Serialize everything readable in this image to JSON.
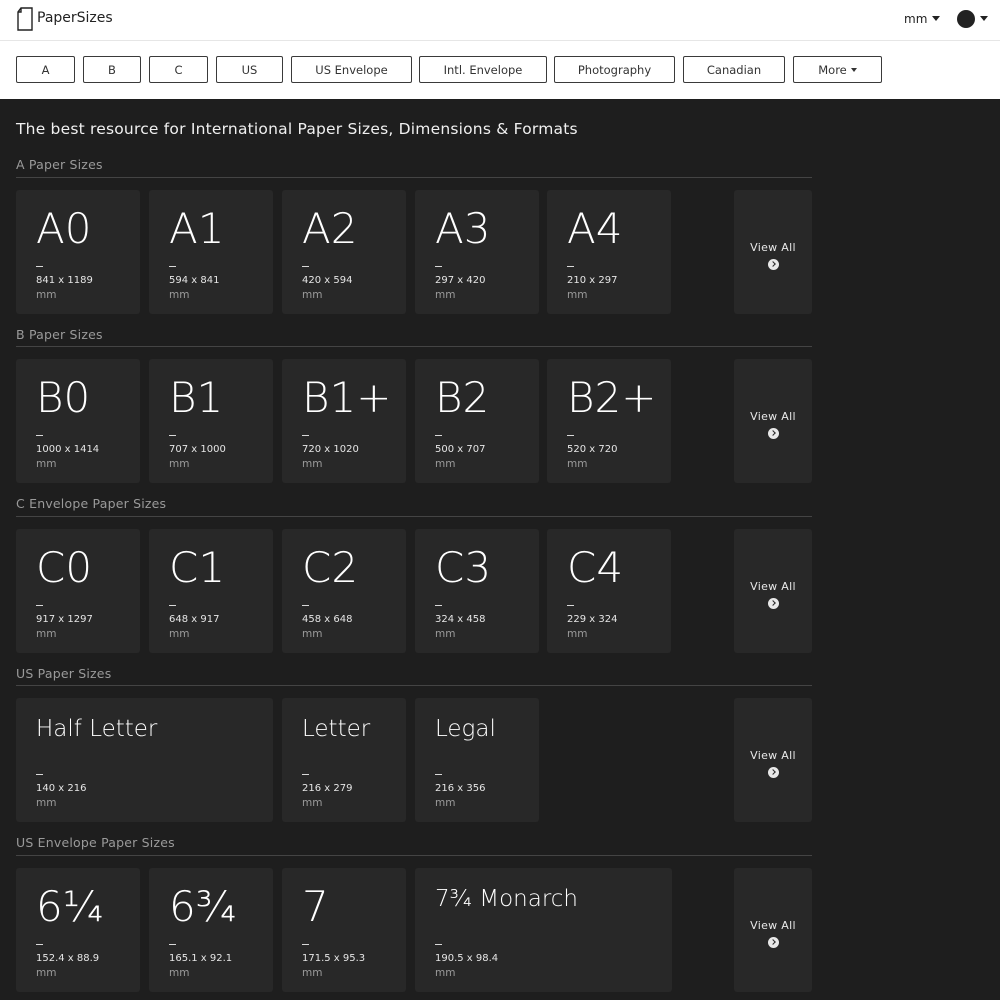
{
  "header": {
    "brand": "PaperSizes",
    "unit_selector": "mm",
    "nav": [
      "A",
      "B",
      "C",
      "US",
      "US Envelope",
      "Intl. Envelope",
      "Photography",
      "Canadian",
      "More"
    ]
  },
  "hero": "The best resource for International Paper Sizes, Dimensions & Formats",
  "view_all_label": "View All",
  "sections": [
    {
      "title": "A Paper Sizes",
      "cards": [
        {
          "name": "A0",
          "dims": "841 x 1189",
          "unit": "mm"
        },
        {
          "name": "A1",
          "dims": "594 x 841",
          "unit": "mm"
        },
        {
          "name": "A2",
          "dims": "420 x 594",
          "unit": "mm"
        },
        {
          "name": "A3",
          "dims": "297 x 420",
          "unit": "mm"
        },
        {
          "name": "A4",
          "dims": "210 x 297",
          "unit": "mm"
        }
      ]
    },
    {
      "title": "B Paper Sizes",
      "cards": [
        {
          "name": "B0",
          "dims": "1000 x 1414",
          "unit": "mm"
        },
        {
          "name": "B1",
          "dims": "707 x 1000",
          "unit": "mm"
        },
        {
          "name": "B1+",
          "dims": "720 x 1020",
          "unit": "mm"
        },
        {
          "name": "B2",
          "dims": "500 x 707",
          "unit": "mm"
        },
        {
          "name": "B2+",
          "dims": "520 x 720",
          "unit": "mm"
        }
      ]
    },
    {
      "title": "C Envelope Paper Sizes",
      "cards": [
        {
          "name": "C0",
          "dims": "917 x 1297",
          "unit": "mm"
        },
        {
          "name": "C1",
          "dims": "648 x 917",
          "unit": "mm"
        },
        {
          "name": "C2",
          "dims": "458 x 648",
          "unit": "mm"
        },
        {
          "name": "C3",
          "dims": "324 x 458",
          "unit": "mm"
        },
        {
          "name": "C4",
          "dims": "229 x 324",
          "unit": "mm"
        }
      ]
    },
    {
      "title": "US Paper Sizes",
      "cards": [
        {
          "name": "Half Letter",
          "dims": "140 x 216",
          "unit": "mm"
        },
        {
          "name": "Letter",
          "dims": "216 x 279",
          "unit": "mm"
        },
        {
          "name": "Legal",
          "dims": "216 x 356",
          "unit": "mm"
        }
      ]
    },
    {
      "title": "US Envelope Paper Sizes",
      "cards": [
        {
          "name": "6¼",
          "dims": "152.4 x 88.9",
          "unit": "mm"
        },
        {
          "name": "6¾",
          "dims": "165.1 x 92.1",
          "unit": "mm"
        },
        {
          "name": "7",
          "dims": "171.5 x 95.3",
          "unit": "mm"
        },
        {
          "name": "7¾ Monarch",
          "dims": "190.5 x 98.4",
          "unit": "mm"
        }
      ]
    }
  ]
}
